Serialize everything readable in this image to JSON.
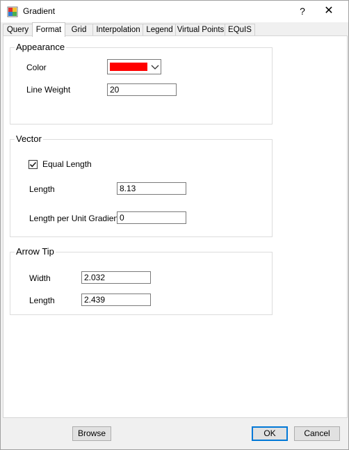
{
  "window": {
    "title": "Gradient",
    "help_glyph": "?",
    "close_glyph": "✕"
  },
  "tabs": [
    {
      "label": "Query"
    },
    {
      "label": "Format"
    },
    {
      "label": "Grid"
    },
    {
      "label": "Interpolation"
    },
    {
      "label": "Legend"
    },
    {
      "label": "Virtual Points"
    },
    {
      "label": "EQuIS"
    }
  ],
  "appearance": {
    "title": "Appearance",
    "color_label": "Color",
    "color_value": "#ff0000",
    "line_weight_label": "Line Weight",
    "line_weight_value": "20"
  },
  "vector": {
    "title": "Vector",
    "equal_length_label": "Equal Length",
    "equal_length_checked": true,
    "length_label": "Length",
    "length_value": "8.13",
    "length_per_unit_label": "Length per Unit Gradient",
    "length_per_unit_value": "0"
  },
  "arrow_tip": {
    "title": "Arrow Tip",
    "width_label": "Width",
    "width_value": "2.032",
    "length_label": "Length",
    "length_value": "2.439"
  },
  "footer": {
    "browse": "Browse",
    "ok": "OK",
    "cancel": "Cancel"
  }
}
